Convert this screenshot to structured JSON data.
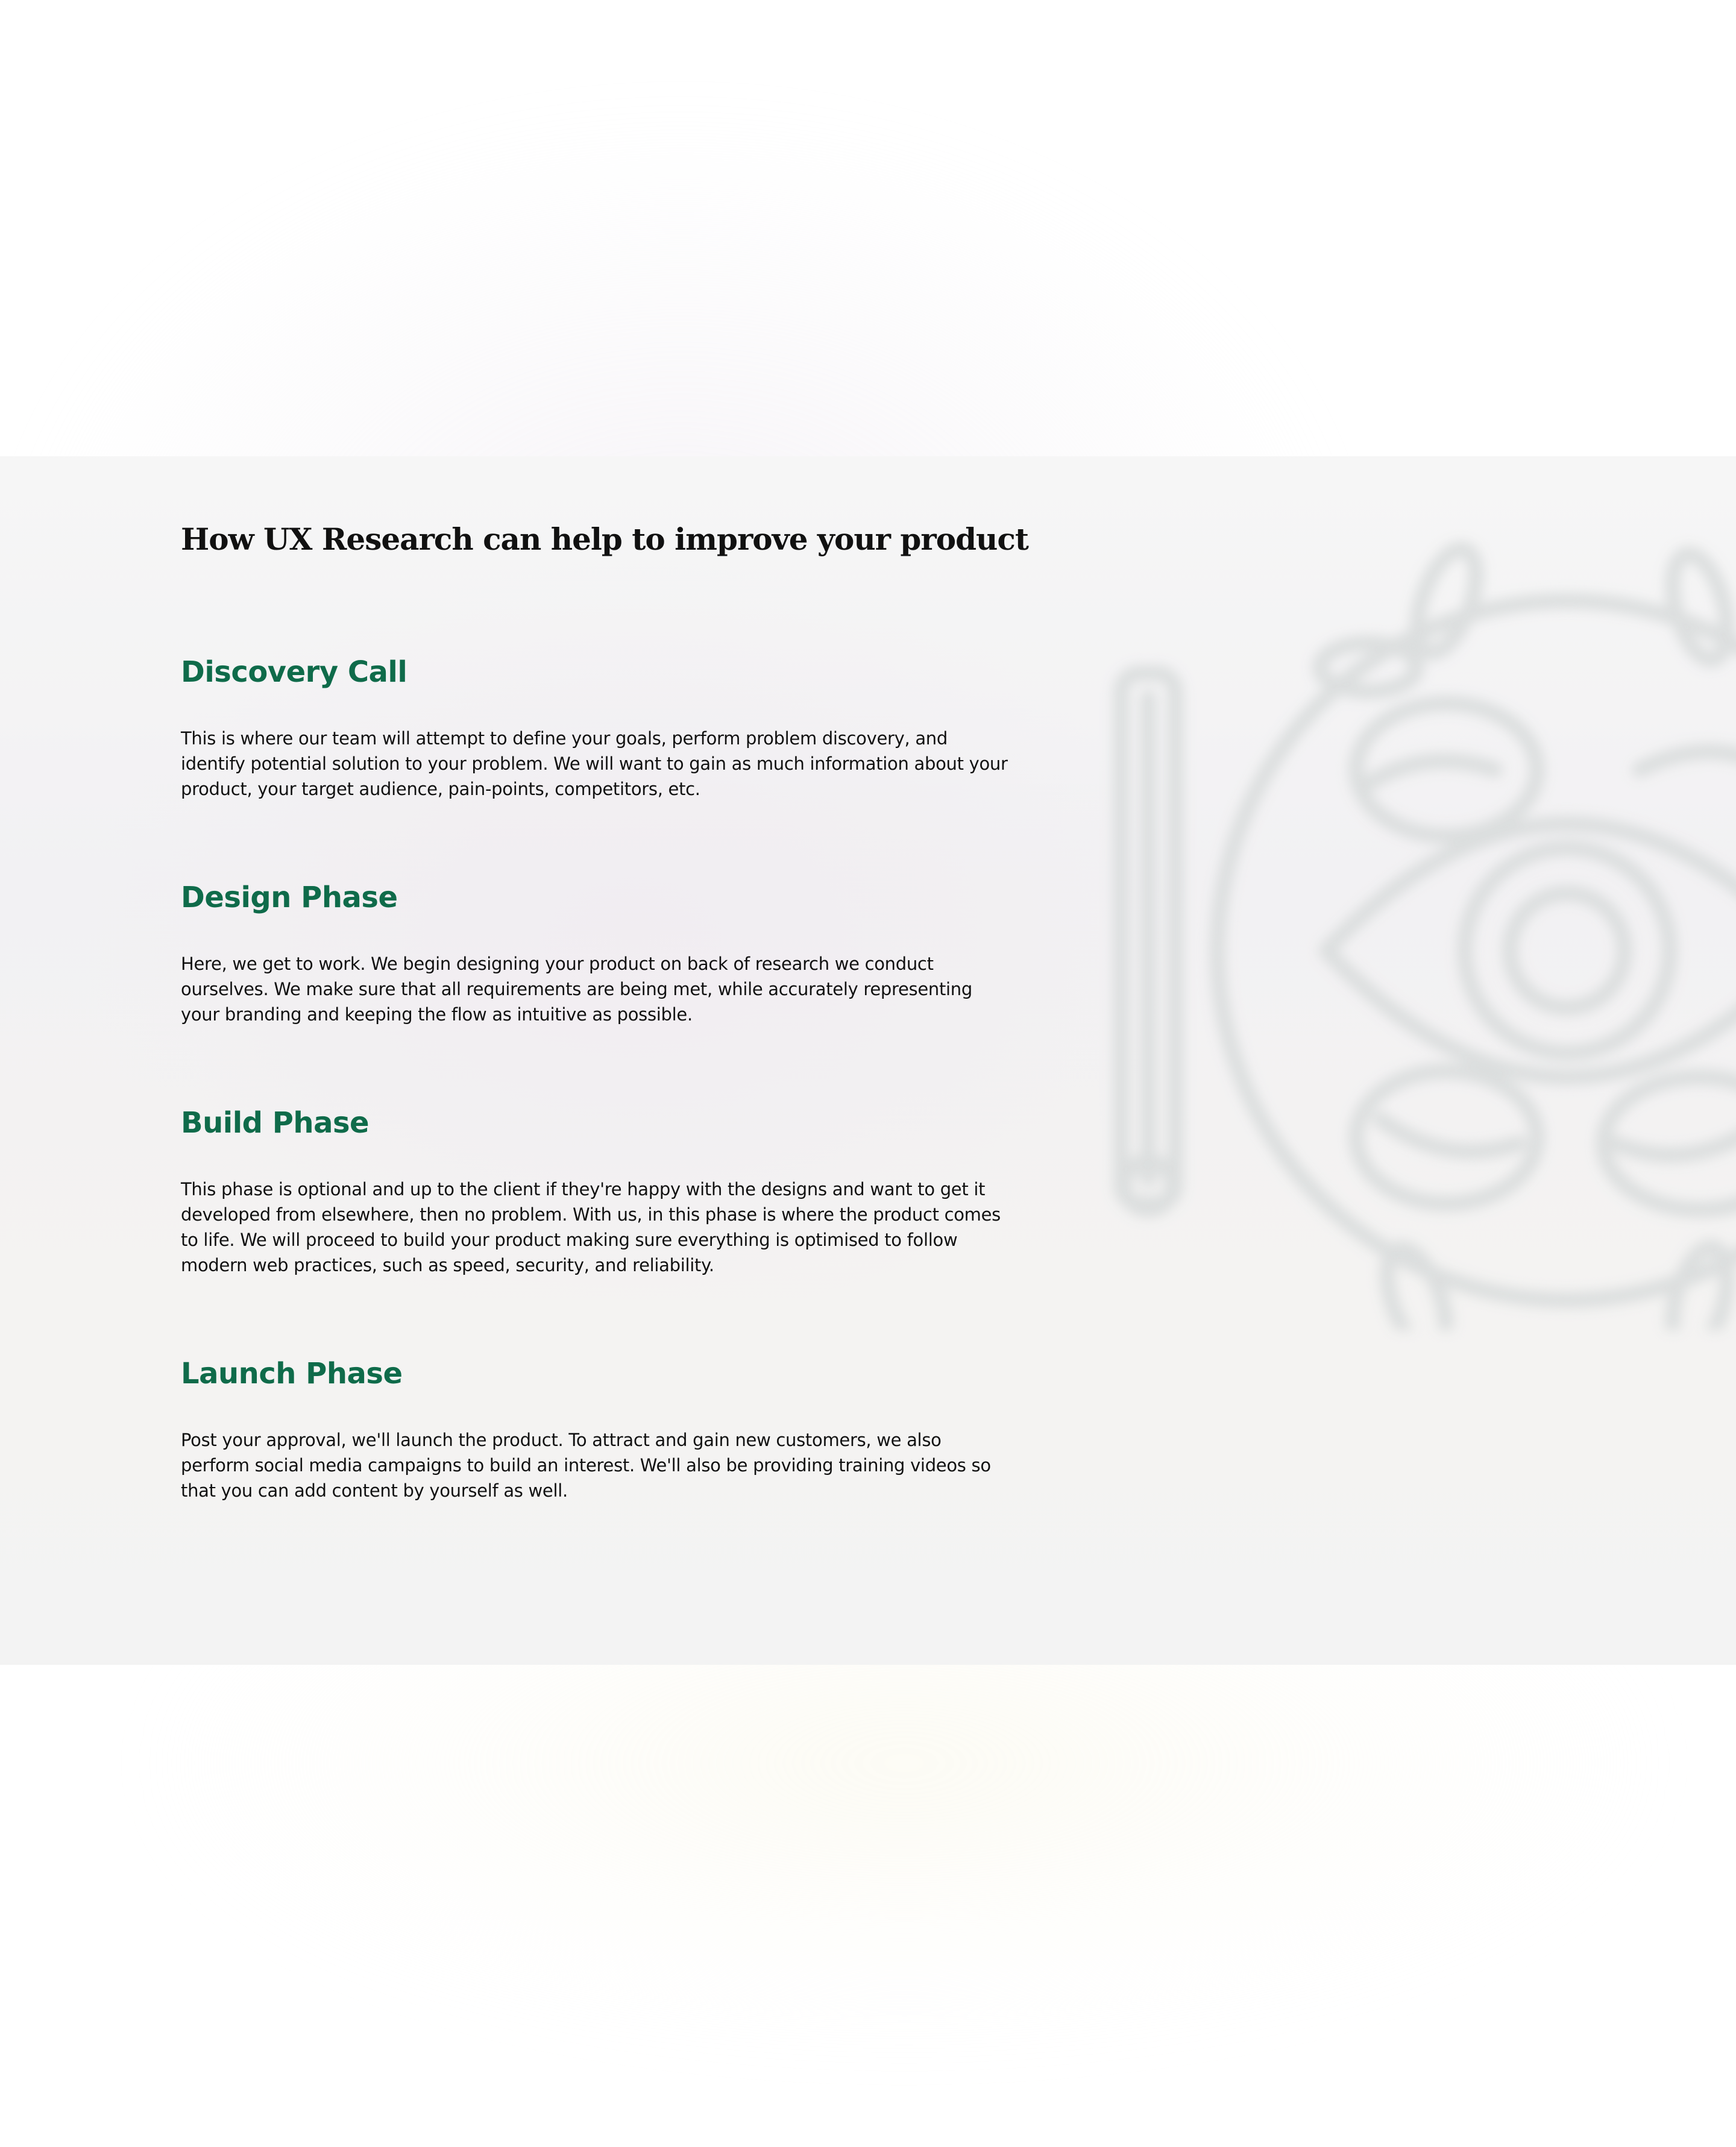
{
  "main": {
    "title": "How UX Research can help to improve your product",
    "phases": [
      {
        "title": "Discovery Call",
        "body": "This is where our team will attempt to define your goals, perform problem discovery, and identify potential solution to your problem. We will want to gain as much information about your product, your target audience, pain-points, competitors, etc."
      },
      {
        "title": "Design Phase",
        "body": "Here, we get to work. We begin designing your product on back of research we conduct ourselves. We make sure that all requirements are being met, while accurately representing your branding and keeping the flow as intuitive as possible."
      },
      {
        "title": "Build Phase",
        "body": "This phase is optional and up to the client if they're happy with the designs and want to get it developed from elsewhere, then no problem. With us, in this phase is where the product comes to life. We will proceed to build your product making sure everything is optimised to follow modern web practices, such as speed, security, and reliability."
      },
      {
        "title": "Launch Phase",
        "body": " Post your approval, we'll launch the product. To attract and gain new customers, we also perform social media campaigns to build an interest. We'll also be providing training videos so that you can add content by yourself as well."
      }
    ]
  },
  "illustration": {
    "icon": "eye-research-icon",
    "color": "#d9dcdc"
  },
  "colors": {
    "accent": "#0f6b4a",
    "text": "#111111",
    "section_bg": "#f3f2f3"
  }
}
